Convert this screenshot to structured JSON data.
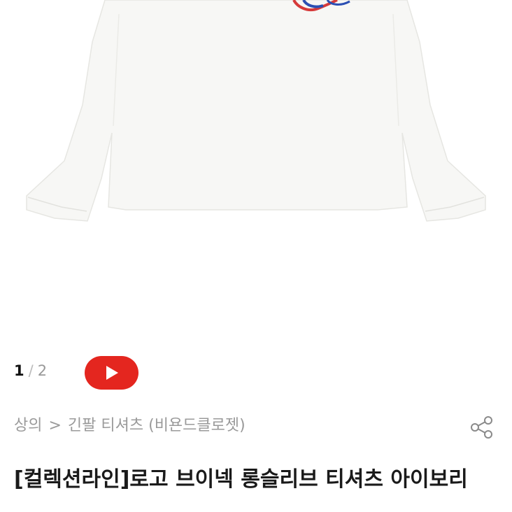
{
  "gallery": {
    "current_page": "1",
    "separator": "/",
    "total_pages": "2",
    "play_icon": "play-icon"
  },
  "breadcrumb": {
    "category": "상의",
    "arrow": ">",
    "subcategory": "긴팔 티셔츠 (비욘드클로젯)"
  },
  "product": {
    "title": "[컬렉션라인]로고 브이넥 롱슬리브 티셔츠 아이보리"
  },
  "icons": {
    "share": "share-icon"
  },
  "colors": {
    "play_button": "#e4261f",
    "breadcrumb_text": "#9a9a9a",
    "title_text": "#1a1a1a",
    "shirt": "#f7f7f5"
  }
}
